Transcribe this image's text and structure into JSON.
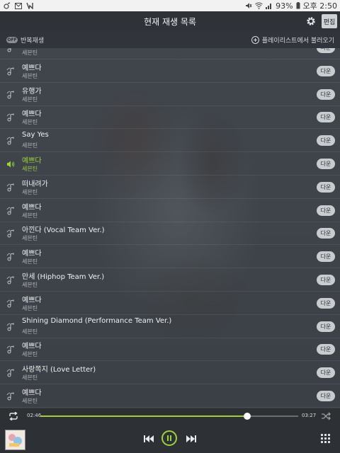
{
  "status_bar": {
    "battery": "93%",
    "time": "오후 2:50"
  },
  "header": {
    "title": "현재 재생 목록",
    "edit_label": "편집"
  },
  "subbar": {
    "repeat_pill": "OFF",
    "repeat_label": "반복재생",
    "load_label": "플레이리스트에서 불러오기"
  },
  "tracks": [
    {
      "title": "",
      "artist": "세븐틴"
    },
    {
      "title": "예쁘다",
      "artist": "세븐틴"
    },
    {
      "title": "유행가",
      "artist": "세븐틴"
    },
    {
      "title": "예쁘다",
      "artist": "세븐틴"
    },
    {
      "title": "Say Yes",
      "artist": "세븐틴"
    },
    {
      "title": "예쁘다",
      "artist": "세븐틴"
    },
    {
      "title": "떠내려가",
      "artist": "세븐틴"
    },
    {
      "title": "예쁘다",
      "artist": "세븐틴"
    },
    {
      "title": "아낀다 (Vocal Team Ver.)",
      "artist": "세븐틴"
    },
    {
      "title": "예쁘다",
      "artist": "세븐틴"
    },
    {
      "title": "만세 (Hiphop Team Ver.)",
      "artist": "세븐틴"
    },
    {
      "title": "예쁘다",
      "artist": "세븐틴"
    },
    {
      "title": "Shining Diamond (Performance Team Ver.)",
      "artist": "세븐틴"
    },
    {
      "title": "예쁘다",
      "artist": "세븐틴"
    },
    {
      "title": "사랑쪽지 (Love Letter)",
      "artist": "세븐틴"
    },
    {
      "title": "예쁘다",
      "artist": "세븐틴"
    }
  ],
  "active_track_index": 5,
  "download_label": "다운",
  "player": {
    "current_time": "02:46",
    "total_time": "03:27",
    "progress_fraction": 0.802
  },
  "colors": {
    "accent": "#9ed13a",
    "header_bg": "#2f3338",
    "list_bg": "#3c4148"
  },
  "icons": {
    "row_icon": "note-icon",
    "active_row_icon": "speaker-icon",
    "repeat": "repeat-icon",
    "shuffle": "shuffle-icon",
    "prev": "previous-icon",
    "pause": "pause-icon",
    "next": "next-icon",
    "grid": "grid-icon",
    "settings": "gear-icon"
  }
}
